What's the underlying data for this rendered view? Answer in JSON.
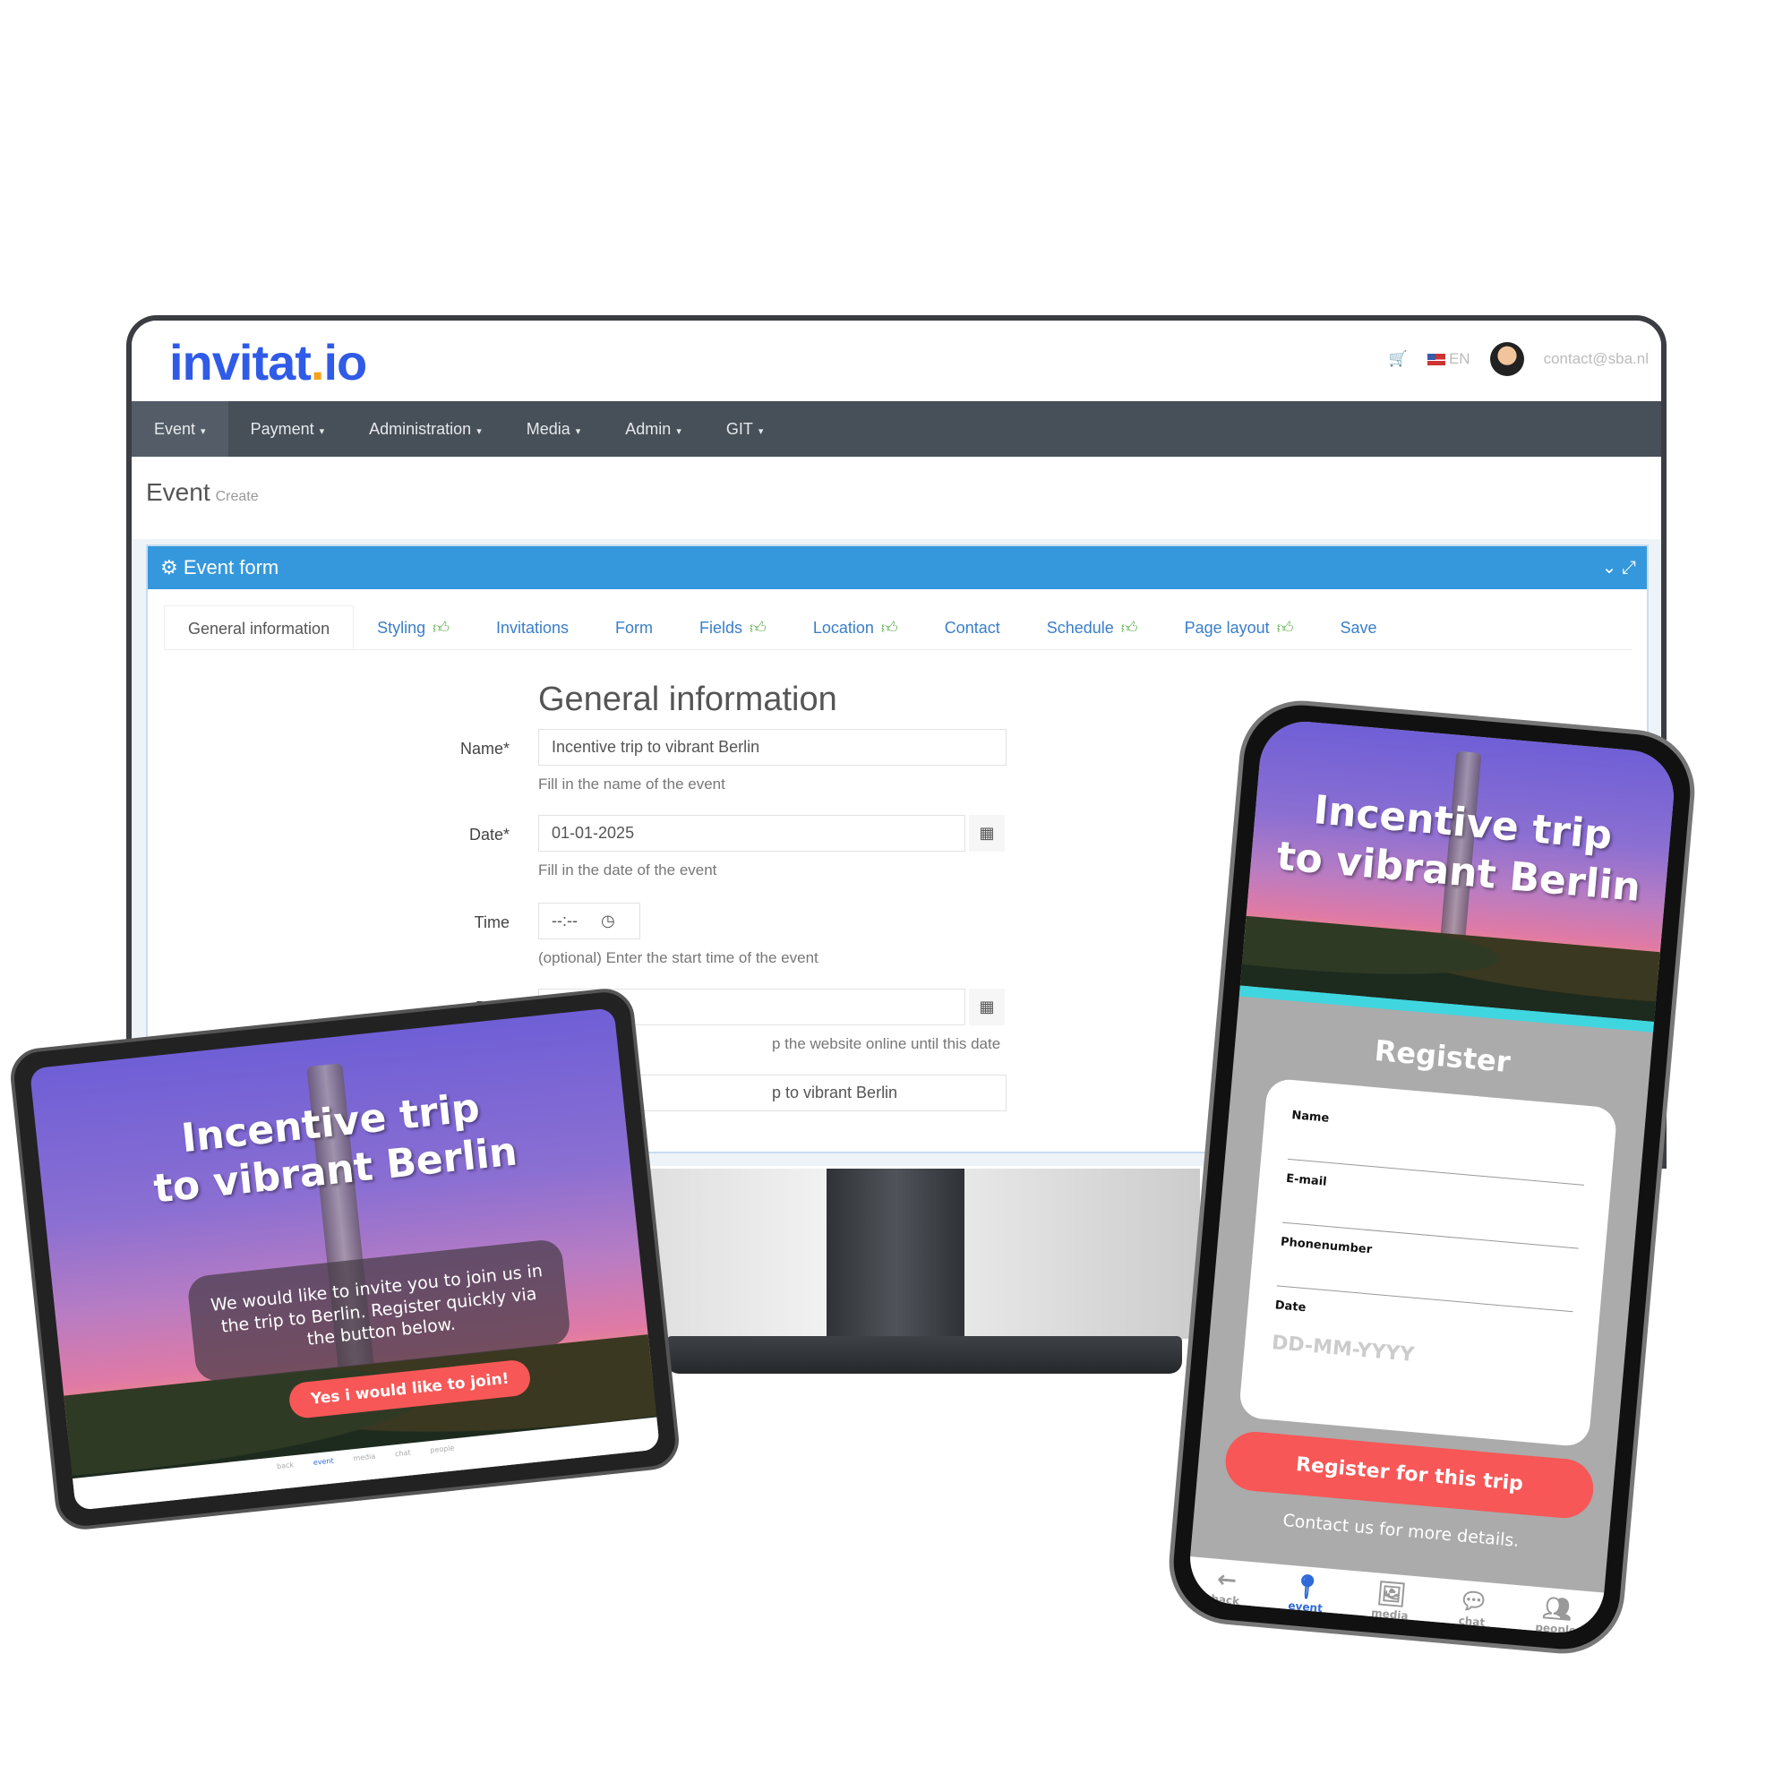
{
  "app": {
    "logo": "invitat.io",
    "language": "EN",
    "user_email": "contact@sba.nl",
    "brand_color": "#2f5be7",
    "accent": "#3598dc"
  },
  "nav": [
    {
      "label": "Event",
      "active": true
    },
    {
      "label": "Payment"
    },
    {
      "label": "Administration"
    },
    {
      "label": "Media"
    },
    {
      "label": "Admin"
    },
    {
      "label": "GIT"
    }
  ],
  "page": {
    "title": "Event",
    "subtitle": "Create"
  },
  "panel": {
    "title": "Event form"
  },
  "tabs": [
    {
      "label": "General information",
      "active": true
    },
    {
      "label": "Styling",
      "check": true
    },
    {
      "label": "Invitations"
    },
    {
      "label": "Form"
    },
    {
      "label": "Fields",
      "check": true
    },
    {
      "label": "Location",
      "check": true
    },
    {
      "label": "Contact"
    },
    {
      "label": "Schedule",
      "check": true
    },
    {
      "label": "Page layout",
      "check": true
    },
    {
      "label": "Save"
    }
  ],
  "form": {
    "heading": "General information",
    "name": {
      "label": "Name*",
      "value": "Incentive trip to vibrant Berlin",
      "help": "Fill in the name of the event"
    },
    "date": {
      "label": "Date*",
      "value": "01-01-2025",
      "help": "Fill in the date of the event"
    },
    "time": {
      "label": "Time",
      "value": "--:--",
      "help": "(optional) Enter the start time of the event"
    },
    "date2": {
      "label": "Date",
      "help": "p the website online until this date"
    },
    "field4": {
      "value": "p to vibrant Berlin"
    }
  },
  "tablet": {
    "title_line1": "Incentive trip",
    "title_line2": "to vibrant Berlin",
    "message": "We would like to invite you to join us in the trip to Berlin. Register quickly via the button below.",
    "button": "Yes i would like to join!",
    "nav": [
      "back",
      "event",
      "media",
      "chat",
      "people"
    ]
  },
  "phone": {
    "title_line1": "Incentive trip",
    "title_line2": "to vibrant Berlin",
    "register_title": "Register",
    "fields": [
      "Name",
      "E-mail",
      "Phonenumber",
      "Date"
    ],
    "date_placeholder": "DD-MM-YYYY",
    "button": "Register for this trip",
    "contact": "Contact us for more details.",
    "nav": [
      {
        "label": "back",
        "icon": "arrow-left-icon"
      },
      {
        "label": "event",
        "icon": "map-pin-icon",
        "active": true
      },
      {
        "label": "media",
        "icon": "image-icon"
      },
      {
        "label": "chat",
        "icon": "chat-icon"
      },
      {
        "label": "people",
        "icon": "people-icon"
      }
    ],
    "button_color": "#f75757",
    "stripe_color": "#3fd6e0"
  }
}
